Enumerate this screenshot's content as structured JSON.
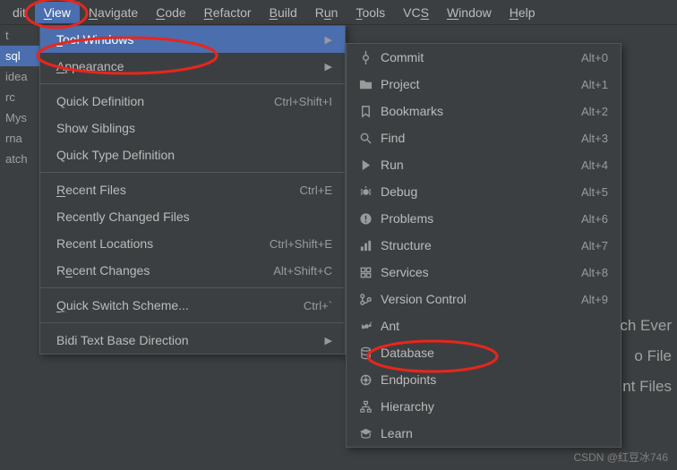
{
  "menubar": [
    {
      "label": "dit",
      "u": null
    },
    {
      "label": "View",
      "u": "V",
      "open": true
    },
    {
      "label": "Navigate",
      "u": "N"
    },
    {
      "label": "Code",
      "u": "C"
    },
    {
      "label": "Refactor",
      "u": "R"
    },
    {
      "label": "Build",
      "u": "B"
    },
    {
      "label": "Run",
      "u": "u"
    },
    {
      "label": "Tools",
      "u": "T"
    },
    {
      "label": "VCS",
      "u": "S"
    },
    {
      "label": "Window",
      "u": "W"
    },
    {
      "label": "Help",
      "u": "H"
    }
  ],
  "left_strip": [
    "t",
    "sql",
    "idea",
    "rc",
    "Mys",
    "rna",
    "atch"
  ],
  "left_selected_index": 1,
  "dropdown": [
    {
      "label": "Tool Windows",
      "u": "T",
      "arrow": true,
      "hl": true
    },
    {
      "label": "Appearance",
      "u": "A",
      "arrow": true
    },
    {
      "sep": true
    },
    {
      "label": "Quick Definition",
      "sc": "Ctrl+Shift+I"
    },
    {
      "label": "Show Siblings"
    },
    {
      "label": "Quick Type Definition"
    },
    {
      "sep": true
    },
    {
      "label": "Recent Files",
      "u": "R",
      "sc": "Ctrl+E"
    },
    {
      "label": "Recently Changed Files"
    },
    {
      "label": "Recent Locations",
      "sc": "Ctrl+Shift+E"
    },
    {
      "label": "Recent Changes",
      "u": "e",
      "sc": "Alt+Shift+C"
    },
    {
      "sep": true
    },
    {
      "label": "Quick Switch Scheme...",
      "u": "Q",
      "sc": "Ctrl+`"
    },
    {
      "sep": true
    },
    {
      "label": "Bidi Text Base Direction",
      "arrow": true
    }
  ],
  "submenu": [
    {
      "icon": "commit",
      "label": "Commit",
      "sc": "Alt+0"
    },
    {
      "icon": "project",
      "label": "Project",
      "sc": "Alt+1"
    },
    {
      "icon": "bookmark",
      "label": "Bookmarks",
      "sc": "Alt+2"
    },
    {
      "icon": "find",
      "label": "Find",
      "sc": "Alt+3"
    },
    {
      "icon": "run",
      "label": "Run",
      "sc": "Alt+4"
    },
    {
      "icon": "debug",
      "label": "Debug",
      "sc": "Alt+5"
    },
    {
      "icon": "problems",
      "label": "Problems",
      "sc": "Alt+6"
    },
    {
      "icon": "structure",
      "label": "Structure",
      "sc": "Alt+7"
    },
    {
      "icon": "services",
      "label": "Services",
      "sc": "Alt+8"
    },
    {
      "icon": "vcs",
      "label": "Version Control",
      "sc": "Alt+9"
    },
    {
      "icon": "ant",
      "label": "Ant"
    },
    {
      "icon": "database",
      "label": "Database"
    },
    {
      "icon": "endpoints",
      "label": "Endpoints"
    },
    {
      "icon": "hierarchy",
      "label": "Hierarchy"
    },
    {
      "icon": "learn",
      "label": "Learn"
    }
  ],
  "bg_text": {
    "a": "ch Ever",
    "b": "o File",
    "c": "nt Files"
  },
  "watermark": "CSDN @红豆冰746"
}
